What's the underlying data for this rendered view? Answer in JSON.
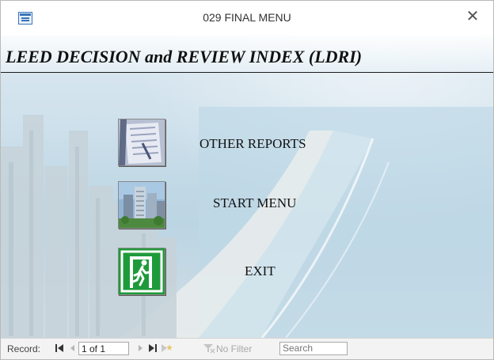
{
  "window": {
    "title": "029 FINAL MENU",
    "close_label": "✕",
    "icon": "form-icon"
  },
  "form": {
    "title": "LEED DECISION and REVIEW INDEX (LDRI)",
    "buttons": [
      {
        "label": "OTHER REPORTS",
        "icon": "document-photo-icon"
      },
      {
        "label": "START MENU",
        "icon": "building-photo-icon"
      },
      {
        "label": "EXIT",
        "icon": "exit-sign-icon"
      }
    ]
  },
  "navigation": {
    "record_label": "Record:",
    "first_icon": "first-record-icon",
    "prev_icon": "previous-record-icon",
    "record_value": "1 of 1",
    "next_icon": "next-record-icon",
    "last_icon": "last-record-icon",
    "new_icon": "new-record-icon",
    "filter_label": "No Filter",
    "filter_icon": "filter-off-icon",
    "search_placeholder": "Search"
  },
  "colors": {
    "exit_green": "#1e9a3a",
    "title_text": "#111111",
    "window_border": "#b9b9b9"
  }
}
